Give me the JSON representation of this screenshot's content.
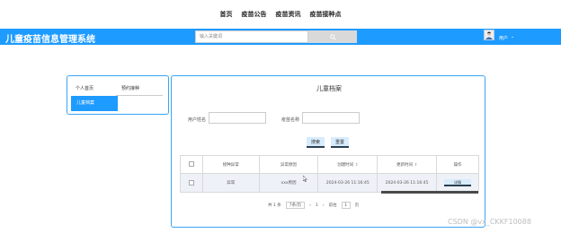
{
  "top_nav": [
    "首页",
    "疫苗公告",
    "疫苗资讯",
    "疫苗接种点"
  ],
  "header": {
    "app_title": "儿童疫苗信息管理系统",
    "search_placeholder": "输入关键词",
    "user_label": "用户",
    "user_caret": "⌄",
    "bg_color": "#1e9bff"
  },
  "sidebar": {
    "items": [
      "个人首页",
      "预约接种"
    ],
    "active_item": "儿童档案"
  },
  "panel": {
    "title": "儿童档案",
    "filters": {
      "username_label": "用户姓名",
      "vaccine_label": "疫苗名称"
    },
    "buttons": {
      "search": "搜索",
      "reset": "重置"
    }
  },
  "table": {
    "columns": [
      "接种异常",
      "异常原因",
      "创建时间",
      "更新时间",
      "操作"
    ],
    "sort_icon": "⇕",
    "rows": [
      {
        "abnormal": "异常",
        "reason": "xxx原因",
        "created": "2024-03-26 11:16:45",
        "updated": "2024-03-26 11:16:45",
        "action": "详情"
      }
    ]
  },
  "pagination": {
    "total_text": "共 1 条",
    "page_size": "7条/页",
    "prev": "‹",
    "current": "1",
    "next": "›",
    "goto_label": "前往",
    "goto_value": "1",
    "goto_suffix": "页"
  },
  "watermark": "CSDN @vx_CKKF10088"
}
